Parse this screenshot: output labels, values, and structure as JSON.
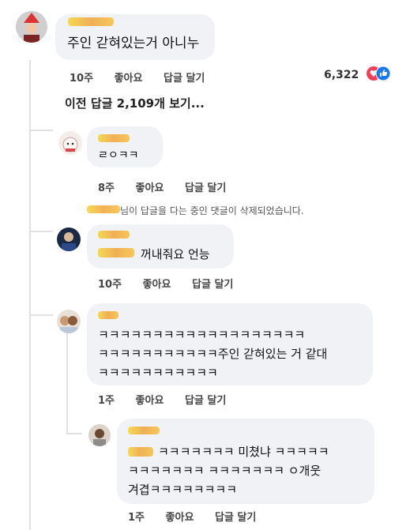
{
  "comments": [
    {
      "id": "c1",
      "text": "주인 갇혀있는거 아니누",
      "time": "10주",
      "like": "좋아요",
      "reply": "답글 달기",
      "reactions": "6,322"
    },
    {
      "id": "c2",
      "text": "ㄹㅇㅋㅋ",
      "time": "8주",
      "like": "좋아요",
      "reply": "답글 달기"
    },
    {
      "id": "c3",
      "text": "꺼내줘요 언능",
      "time": "10주",
      "like": "좋아요",
      "reply": "답글 달기"
    },
    {
      "id": "c4",
      "lines": [
        "ㅋㅋㅋㅋㅋㅋㅋㅋㅋㅋㅋㅋㅋㅋㅋㅋㅋㅋㅋ",
        "ㅋㅋㅋㅋㅋㅋㅋㅋㅋㅋㅋ주인 갇혀있는 거 같대",
        "ㅋㅋㅋㅋㅋㅋㅋㅋㅋㅋㅋ"
      ],
      "time": "1주",
      "like": "좋아요",
      "reply": "답글 달기"
    },
    {
      "id": "c5",
      "lines": [
        "ㅋㅋㅋㅋㅋㅋㅋ 미쳤냐 ㅋㅋㅋㅋㅋ",
        "ㅋㅋㅋㅋㅋㅋㅋ ㅋㅋㅋㅋㅋㅋㅋ ㅇ개웃",
        "겨겹ㅋㅋㅋㅋㅋㅋㅋㅋ"
      ],
      "time": "1주",
      "like": "좋아요",
      "reply": "답글 달기"
    }
  ],
  "more_replies": "이전 답글 2,109개 보기...",
  "deleted_notice": "님이 답글을 다는 중인 댓글이 삭제되었습니다.",
  "deleted_notice_suffix": "님이 답글을 다는 중인 댓글이 삭제되었습니다.",
  "colors": {
    "bubble": "#f0f2f5",
    "line": "#dfe1e5",
    "like_blue": "#1877f2",
    "heart_red": "#f33e58",
    "redaction": "#f5c542"
  },
  "icons": [
    "like-icon",
    "love-icon"
  ]
}
